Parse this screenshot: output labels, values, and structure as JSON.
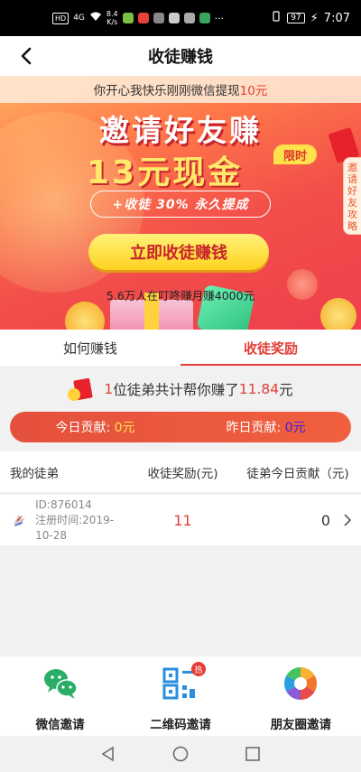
{
  "status_bar": {
    "network": "HD",
    "signal": "4G",
    "speed_value": "8.4",
    "speed_unit": "K/s",
    "more": "···",
    "battery": "97",
    "time": "7:07"
  },
  "nav": {
    "title": "收徒赚钱"
  },
  "banner": {
    "ticker_prefix": "你开心我快乐刚刚微信提现",
    "ticker_amount": "10元",
    "headline": "邀请好友赚",
    "amount": "13元现金",
    "limit_badge": "限时",
    "promise": "+收徒 30% 永久提成",
    "cta": "立即收徒赚钱",
    "social_proof": "5.6万人在叮咚赚月赚4000元",
    "side_tab": [
      "邀",
      "请",
      "好",
      "友",
      "攻",
      "略"
    ]
  },
  "tabs": [
    {
      "label": "如何赚钱",
      "active": false
    },
    {
      "label": "收徒奖励",
      "active": true
    }
  ],
  "summary": {
    "count": "1",
    "middle": "位徒弟共计帮你赚了",
    "amount": "11.84",
    "unit": "元"
  },
  "contrib": {
    "today_label": "今日贡献: ",
    "today_value": "0元",
    "yesterday_label": "昨日贡献: ",
    "yesterday_value": "0元"
  },
  "table": {
    "headers": [
      "我的徒弟",
      "收徒奖励(元)",
      "徒弟今日贡献（元)"
    ],
    "rows": [
      {
        "id": "ID:876014",
        "registered": "注册时间:2019-10-28",
        "reward": "11",
        "today": "0"
      }
    ]
  },
  "share": [
    {
      "label": "微信邀请",
      "icon": "wechat-icon"
    },
    {
      "label": "二维码邀请",
      "icon": "qrcode-icon",
      "badge": "热"
    },
    {
      "label": "朋友圈邀请",
      "icon": "moments-icon"
    }
  ],
  "colors": {
    "accent": "#e23e36",
    "cta": "#ffd21e",
    "wechat": "#2aae67"
  }
}
